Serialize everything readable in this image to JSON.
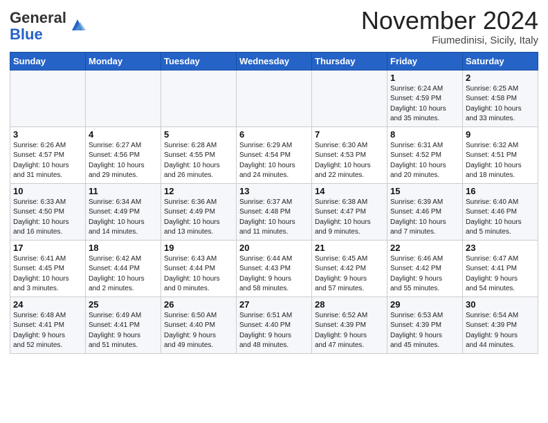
{
  "header": {
    "logo_general": "General",
    "logo_blue": "Blue",
    "month_title": "November 2024",
    "location": "Fiumedinisi, Sicily, Italy"
  },
  "weekdays": [
    "Sunday",
    "Monday",
    "Tuesday",
    "Wednesday",
    "Thursday",
    "Friday",
    "Saturday"
  ],
  "weeks": [
    [
      {
        "day": "",
        "info": ""
      },
      {
        "day": "",
        "info": ""
      },
      {
        "day": "",
        "info": ""
      },
      {
        "day": "",
        "info": ""
      },
      {
        "day": "",
        "info": ""
      },
      {
        "day": "1",
        "info": "Sunrise: 6:24 AM\nSunset: 4:59 PM\nDaylight: 10 hours\nand 35 minutes."
      },
      {
        "day": "2",
        "info": "Sunrise: 6:25 AM\nSunset: 4:58 PM\nDaylight: 10 hours\nand 33 minutes."
      }
    ],
    [
      {
        "day": "3",
        "info": "Sunrise: 6:26 AM\nSunset: 4:57 PM\nDaylight: 10 hours\nand 31 minutes."
      },
      {
        "day": "4",
        "info": "Sunrise: 6:27 AM\nSunset: 4:56 PM\nDaylight: 10 hours\nand 29 minutes."
      },
      {
        "day": "5",
        "info": "Sunrise: 6:28 AM\nSunset: 4:55 PM\nDaylight: 10 hours\nand 26 minutes."
      },
      {
        "day": "6",
        "info": "Sunrise: 6:29 AM\nSunset: 4:54 PM\nDaylight: 10 hours\nand 24 minutes."
      },
      {
        "day": "7",
        "info": "Sunrise: 6:30 AM\nSunset: 4:53 PM\nDaylight: 10 hours\nand 22 minutes."
      },
      {
        "day": "8",
        "info": "Sunrise: 6:31 AM\nSunset: 4:52 PM\nDaylight: 10 hours\nand 20 minutes."
      },
      {
        "day": "9",
        "info": "Sunrise: 6:32 AM\nSunset: 4:51 PM\nDaylight: 10 hours\nand 18 minutes."
      }
    ],
    [
      {
        "day": "10",
        "info": "Sunrise: 6:33 AM\nSunset: 4:50 PM\nDaylight: 10 hours\nand 16 minutes."
      },
      {
        "day": "11",
        "info": "Sunrise: 6:34 AM\nSunset: 4:49 PM\nDaylight: 10 hours\nand 14 minutes."
      },
      {
        "day": "12",
        "info": "Sunrise: 6:36 AM\nSunset: 4:49 PM\nDaylight: 10 hours\nand 13 minutes."
      },
      {
        "day": "13",
        "info": "Sunrise: 6:37 AM\nSunset: 4:48 PM\nDaylight: 10 hours\nand 11 minutes."
      },
      {
        "day": "14",
        "info": "Sunrise: 6:38 AM\nSunset: 4:47 PM\nDaylight: 10 hours\nand 9 minutes."
      },
      {
        "day": "15",
        "info": "Sunrise: 6:39 AM\nSunset: 4:46 PM\nDaylight: 10 hours\nand 7 minutes."
      },
      {
        "day": "16",
        "info": "Sunrise: 6:40 AM\nSunset: 4:46 PM\nDaylight: 10 hours\nand 5 minutes."
      }
    ],
    [
      {
        "day": "17",
        "info": "Sunrise: 6:41 AM\nSunset: 4:45 PM\nDaylight: 10 hours\nand 3 minutes."
      },
      {
        "day": "18",
        "info": "Sunrise: 6:42 AM\nSunset: 4:44 PM\nDaylight: 10 hours\nand 2 minutes."
      },
      {
        "day": "19",
        "info": "Sunrise: 6:43 AM\nSunset: 4:44 PM\nDaylight: 10 hours\nand 0 minutes."
      },
      {
        "day": "20",
        "info": "Sunrise: 6:44 AM\nSunset: 4:43 PM\nDaylight: 9 hours\nand 58 minutes."
      },
      {
        "day": "21",
        "info": "Sunrise: 6:45 AM\nSunset: 4:42 PM\nDaylight: 9 hours\nand 57 minutes."
      },
      {
        "day": "22",
        "info": "Sunrise: 6:46 AM\nSunset: 4:42 PM\nDaylight: 9 hours\nand 55 minutes."
      },
      {
        "day": "23",
        "info": "Sunrise: 6:47 AM\nSunset: 4:41 PM\nDaylight: 9 hours\nand 54 minutes."
      }
    ],
    [
      {
        "day": "24",
        "info": "Sunrise: 6:48 AM\nSunset: 4:41 PM\nDaylight: 9 hours\nand 52 minutes."
      },
      {
        "day": "25",
        "info": "Sunrise: 6:49 AM\nSunset: 4:41 PM\nDaylight: 9 hours\nand 51 minutes."
      },
      {
        "day": "26",
        "info": "Sunrise: 6:50 AM\nSunset: 4:40 PM\nDaylight: 9 hours\nand 49 minutes."
      },
      {
        "day": "27",
        "info": "Sunrise: 6:51 AM\nSunset: 4:40 PM\nDaylight: 9 hours\nand 48 minutes."
      },
      {
        "day": "28",
        "info": "Sunrise: 6:52 AM\nSunset: 4:39 PM\nDaylight: 9 hours\nand 47 minutes."
      },
      {
        "day": "29",
        "info": "Sunrise: 6:53 AM\nSunset: 4:39 PM\nDaylight: 9 hours\nand 45 minutes."
      },
      {
        "day": "30",
        "info": "Sunrise: 6:54 AM\nSunset: 4:39 PM\nDaylight: 9 hours\nand 44 minutes."
      }
    ]
  ]
}
